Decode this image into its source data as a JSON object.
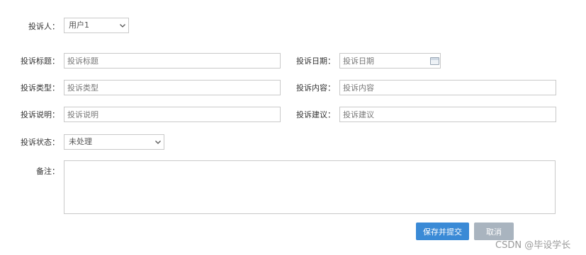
{
  "form": {
    "complainant": {
      "label": "投诉人：",
      "value": "用户1"
    },
    "title": {
      "label": "投诉标题：",
      "placeholder": "投诉标题"
    },
    "date": {
      "label": "投诉日期：",
      "placeholder": "投诉日期"
    },
    "type": {
      "label": "投诉类型：",
      "placeholder": "投诉类型"
    },
    "content": {
      "label": "投诉内容：",
      "placeholder": "投诉内容"
    },
    "description": {
      "label": "投诉说明：",
      "placeholder": "投诉说明"
    },
    "suggestion": {
      "label": "投诉建议：",
      "placeholder": "投诉建议"
    },
    "status": {
      "label": "投诉状态：",
      "value": "未处理"
    },
    "remark": {
      "label": "备注：",
      "value": ""
    }
  },
  "actions": {
    "submit_label": "保存并提交",
    "cancel_label": "取消"
  },
  "watermark": "CSDN @毕设学长",
  "colors": {
    "border": "#c9c9c9",
    "submit_bg": "#3a8ad6",
    "cancel_bg": "#a9b4bf"
  },
  "icons": [
    "chevron-down-icon",
    "calendar-icon"
  ]
}
